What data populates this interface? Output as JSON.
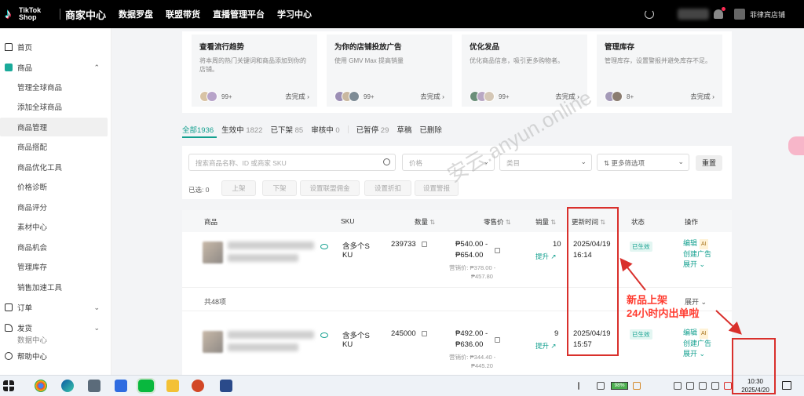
{
  "topbar": {
    "logo_line1": "TikTok",
    "logo_line2": "Shop",
    "nav": [
      "商家中心",
      "数据罗盘",
      "联盟带货",
      "直播管理平台",
      "学习中心"
    ],
    "shop_name": "菲律宾店铺"
  },
  "sidebar": {
    "home": "首页",
    "products": "商品",
    "product_items": [
      "管理全球商品",
      "添加全球商品",
      "商品管理",
      "商品搭配",
      "商品优化工具",
      "价格诊断",
      "商品评分",
      "素材中心",
      "商品机会",
      "管理库存",
      "销售加速工具"
    ],
    "active_item": "商品管理",
    "orders": "订单",
    "shipping": "发货",
    "partial": "数据中心",
    "help": "帮助中心"
  },
  "cards": [
    {
      "title": "查看流行趋势",
      "desc": "将本周的热门关键词和商品添加到你的店铺。",
      "count": "99+",
      "link": "去完成 ›",
      "colors": [
        "#d8c3a5",
        "#b7a3c9"
      ]
    },
    {
      "title": "为你的店铺投放广告",
      "desc": "使用 GMV Max 提高销量",
      "count": "99+",
      "link": "去完成 ›",
      "colors": [
        "#9c8fb5",
        "#c9b8a0",
        "#7e8c96"
      ]
    },
    {
      "title": "优化发品",
      "desc": "优化商品信息，吸引更多购物者。",
      "count": "99+",
      "link": "去完成 ›",
      "colors": [
        "#6b8f7a",
        "#b9a8c4",
        "#d4c7b6"
      ]
    },
    {
      "title": "管理库存",
      "desc": "管理库存，设置警报并避免库存不足。",
      "count": "8+",
      "link": "去完成 ›",
      "colors": [
        "#a49ab8",
        "#8a7c70"
      ]
    }
  ],
  "tabs": [
    {
      "label": "全部",
      "count": "1936"
    },
    {
      "label": "生效中",
      "count": "1822"
    },
    {
      "label": "已下架",
      "count": "85"
    },
    {
      "label": "审核中",
      "count": "0"
    },
    {
      "label": "已暂停",
      "count": "29"
    },
    {
      "label": "草稿",
      "count": ""
    },
    {
      "label": "已删除",
      "count": ""
    }
  ],
  "filters": {
    "search_placeholder": "搜索商品名称、ID 或商家 SKU",
    "price_placeholder": "价格",
    "category_placeholder": "类目",
    "more_filters": "更多筛选项",
    "reset": "重置",
    "selected_label": "已选: 0",
    "bulk_actions": [
      "上架",
      "下架",
      "设置联盟佣金",
      "设置折扣",
      "设置警报"
    ]
  },
  "table": {
    "headers": {
      "product": "商品",
      "sku": "SKU",
      "qty": "数量",
      "price": "零售价",
      "sales": "销量",
      "updated": "更新时间",
      "status": "状态",
      "actions": "操作"
    },
    "rows": [
      {
        "sku_line1": "含多个S",
        "sku_line2": "KU",
        "quantity": "239733",
        "price_main1": "₱540.00 -",
        "price_main2": "₱654.00",
        "price_sub_label": "营销价: ₱378.00 -",
        "price_sub2": "₱457.80",
        "sales": "10",
        "boost": "提升",
        "updated_date": "2025/04/19",
        "updated_time": "16:14",
        "status": "已生效",
        "op_edit": "编辑",
        "op_ai": "AI",
        "op_ad": "创建广告",
        "op_expand": "展开 ⌄"
      },
      {
        "sku_line1": "含多个S",
        "sku_line2": "KU",
        "quantity": "245000",
        "price_main1": "₱492.00 -",
        "price_main2": "₱636.00",
        "price_sub_label": "营销价: ₱344.40 -",
        "price_sub2": "₱445.20",
        "sales": "9",
        "boost": "提升",
        "updated_date": "2025/04/19",
        "updated_time": "15:57",
        "status": "已生效",
        "op_edit": "编辑",
        "op_ai": "AI",
        "op_ad": "创建广告",
        "op_expand": "展开 ⌄"
      }
    ],
    "group_total": "共48项",
    "group_expand": "展开 ⌄"
  },
  "annotation": {
    "line1": "新品上架",
    "line2": "24小时内出单啦",
    "color": "#ff3b2f"
  },
  "watermark": "安云.anyun.online",
  "taskbar": {
    "battery": "98%",
    "time": "10:30",
    "date": "2025/4/20"
  },
  "accent_color": "#13a08f"
}
